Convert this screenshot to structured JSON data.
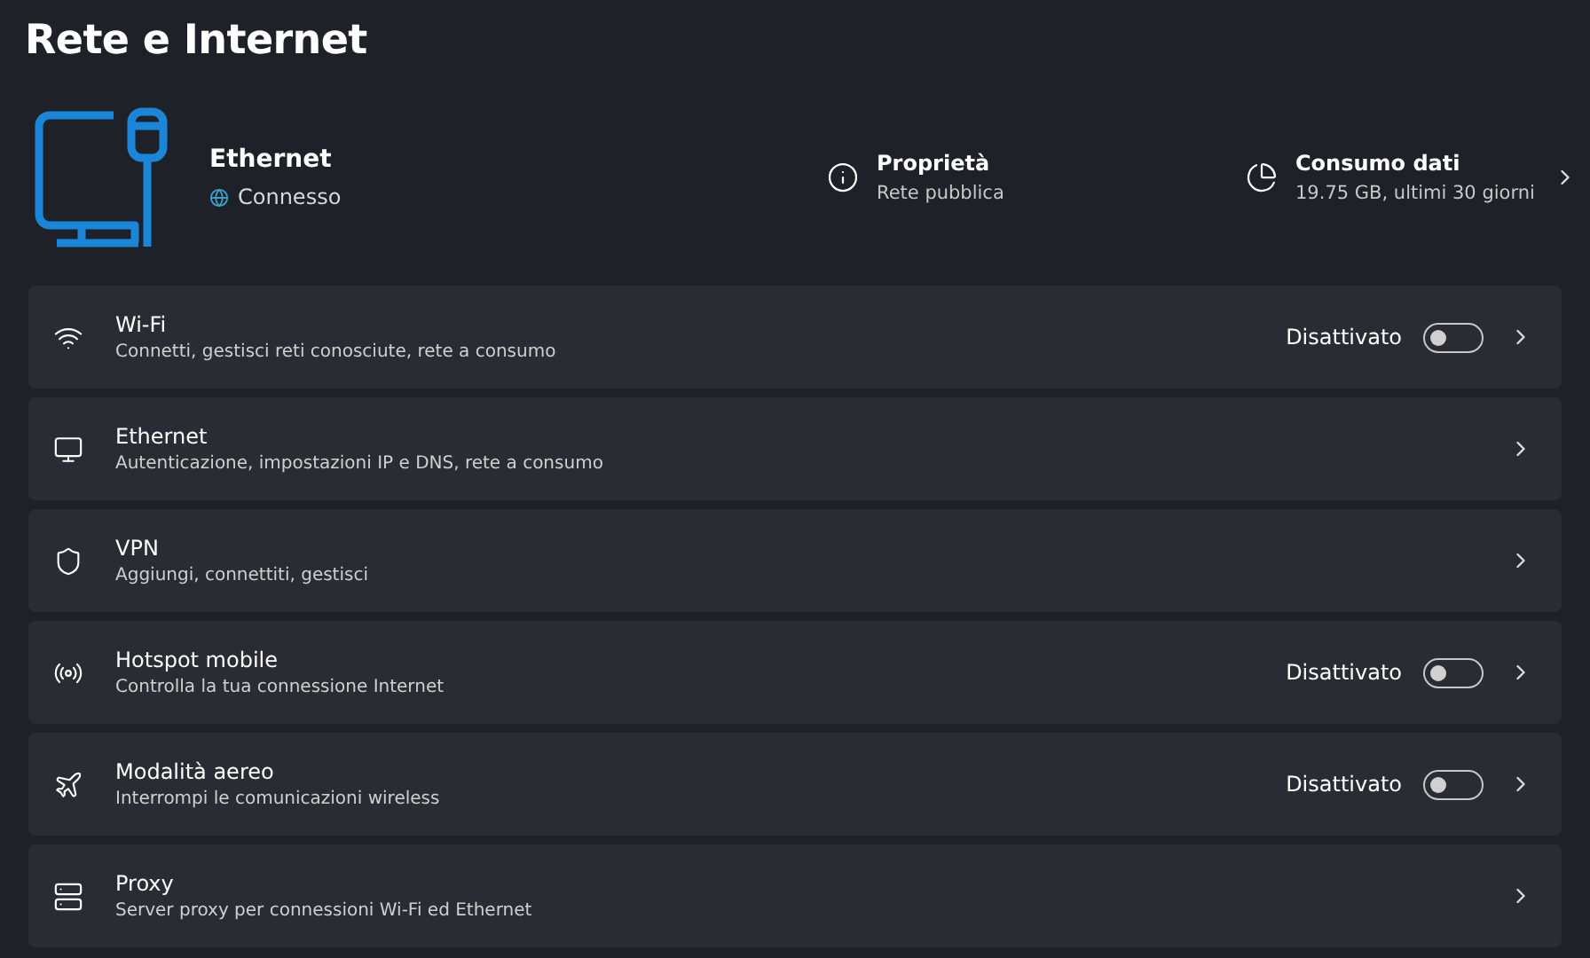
{
  "page": {
    "title": "Rete e Internet"
  },
  "connection": {
    "name": "Ethernet",
    "status": "Connesso"
  },
  "summary": [
    {
      "kind": "properties",
      "title": "Proprietà",
      "subtitle": "Rete pubblica",
      "chevron": false
    },
    {
      "kind": "data-usage",
      "title": "Consumo dati",
      "subtitle": "19.75 GB, ultimi 30 giorni",
      "chevron": true
    }
  ],
  "settings": [
    {
      "kind": "wifi",
      "title": "Wi-Fi",
      "subtitle": "Connetti, gestisci reti conosciute, rete a consumo",
      "toggle": {
        "label": "Disattivato",
        "on": false
      }
    },
    {
      "kind": "ethernet",
      "title": "Ethernet",
      "subtitle": "Autenticazione, impostazioni IP e DNS, rete a consumo"
    },
    {
      "kind": "vpn",
      "title": "VPN",
      "subtitle": "Aggiungi, connettiti, gestisci"
    },
    {
      "kind": "hotspot",
      "title": "Hotspot mobile",
      "subtitle": "Controlla la tua connessione Internet",
      "toggle": {
        "label": "Disattivato",
        "on": false
      }
    },
    {
      "kind": "airplane",
      "title": "Modalità aereo",
      "subtitle": "Interrompi le comunicazioni wireless",
      "toggle": {
        "label": "Disattivato",
        "on": false
      }
    },
    {
      "kind": "proxy",
      "title": "Proxy",
      "subtitle": "Server proxy per connessioni Wi-Fi ed Ethernet"
    }
  ]
}
